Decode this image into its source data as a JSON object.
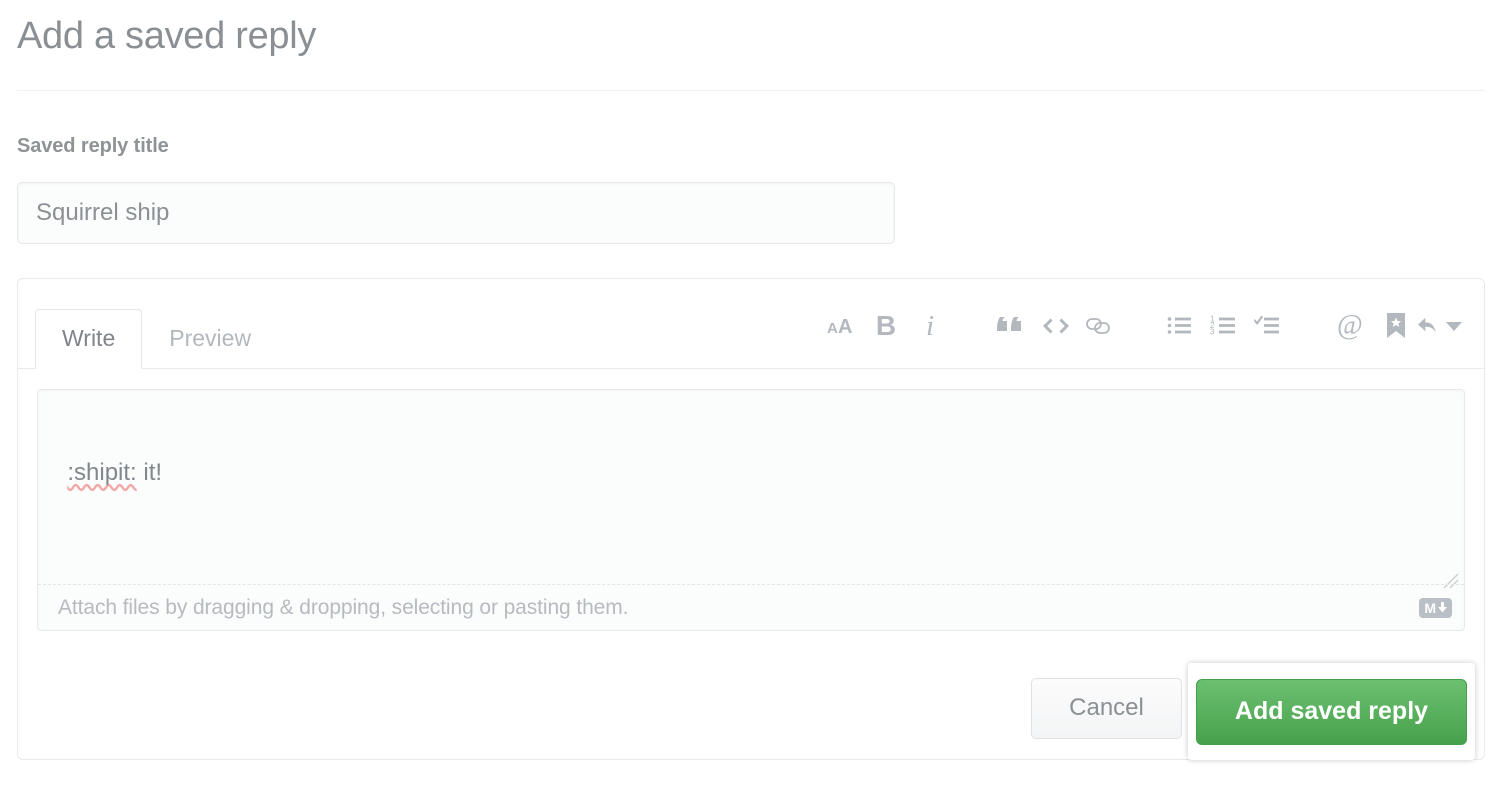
{
  "page": {
    "title": "Add a saved reply"
  },
  "form": {
    "title_field": {
      "label": "Saved reply title",
      "value": "Squirrel ship",
      "placeholder": "Saved reply title"
    },
    "body_field": {
      "value": ":shipit: it!",
      "misspelled_word": ":shipit:",
      "rest_text": " it!",
      "placeholder": ""
    }
  },
  "editor": {
    "tabs": [
      {
        "label": "Write",
        "active": true
      },
      {
        "label": "Preview",
        "active": false
      }
    ],
    "toolbar": [
      {
        "name": "heading-icon",
        "glyph": "AA",
        "title": "Add header text"
      },
      {
        "name": "bold-icon",
        "glyph": "B",
        "title": "Add bold text"
      },
      {
        "name": "italic-icon",
        "glyph": "i",
        "title": "Add italic text"
      },
      {
        "name": "quote-icon",
        "glyph": "“",
        "title": "Insert a quote"
      },
      {
        "name": "code-icon",
        "glyph": "<>",
        "title": "Insert code"
      },
      {
        "name": "link-icon",
        "glyph": "link",
        "title": "Add a link"
      },
      {
        "name": "unordered-list-icon",
        "glyph": "bullets",
        "title": "Add a bulleted list"
      },
      {
        "name": "ordered-list-icon",
        "glyph": "123",
        "title": "Add a numbered list"
      },
      {
        "name": "task-list-icon",
        "glyph": "check",
        "title": "Add a task list"
      },
      {
        "name": "mention-icon",
        "glyph": "@",
        "title": "Directly mention a user or team"
      },
      {
        "name": "saved-reply-icon",
        "glyph": "bookmark",
        "title": "Reference a saved reply"
      },
      {
        "name": "reply-icon",
        "glyph": "reply",
        "title": "Reply"
      }
    ],
    "attach": {
      "text": "Attach files by dragging & dropping, selecting or pasting them.",
      "markdown_badge": "M"
    }
  },
  "actions": {
    "cancel_label": "Cancel",
    "submit_label": "Add saved reply"
  },
  "colors": {
    "primary_green": "#4caf50",
    "text_gray": "#8a8f94",
    "muted_gray": "#b2b8bd",
    "border_gray": "#e8eaec",
    "spellcheck_red": "#f3a6a6"
  }
}
